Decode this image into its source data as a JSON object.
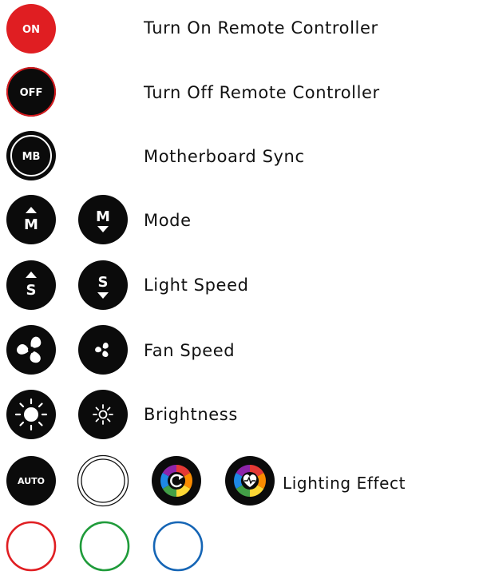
{
  "rows": {
    "on": {
      "badge": "ON",
      "label": "Turn On Remote Controller",
      "color": "#e01e22"
    },
    "off": {
      "badge": "OFF",
      "label": "Turn Off Remote Controller",
      "ring": "#d61a1e"
    },
    "mb": {
      "badge": "MB",
      "label": "Motherboard Sync"
    },
    "mode": {
      "label": "Mode",
      "icons": [
        "mode-up-icon",
        "mode-down-icon"
      ]
    },
    "light_speed": {
      "label": "Light Speed",
      "icons": [
        "speed-up-icon",
        "speed-down-icon"
      ]
    },
    "fan_speed": {
      "label": "Fan Speed",
      "icons": [
        "fan-large-icon",
        "fan-small-icon"
      ]
    },
    "brightness": {
      "label": "Brightness",
      "icons": [
        "sun-large-icon",
        "sun-small-icon"
      ]
    },
    "lighting_effect": {
      "badge": "AUTO",
      "label": "Lighting Effect",
      "icons": [
        "auto-button",
        "white-ring",
        "rainbow-cycle-icon",
        "rainbow-heartbeat-icon"
      ]
    }
  },
  "color_rings": [
    {
      "name": "red",
      "color": "#e01e22"
    },
    {
      "name": "green",
      "color": "#1f9b3a"
    },
    {
      "name": "blue",
      "color": "#1565b5"
    }
  ]
}
